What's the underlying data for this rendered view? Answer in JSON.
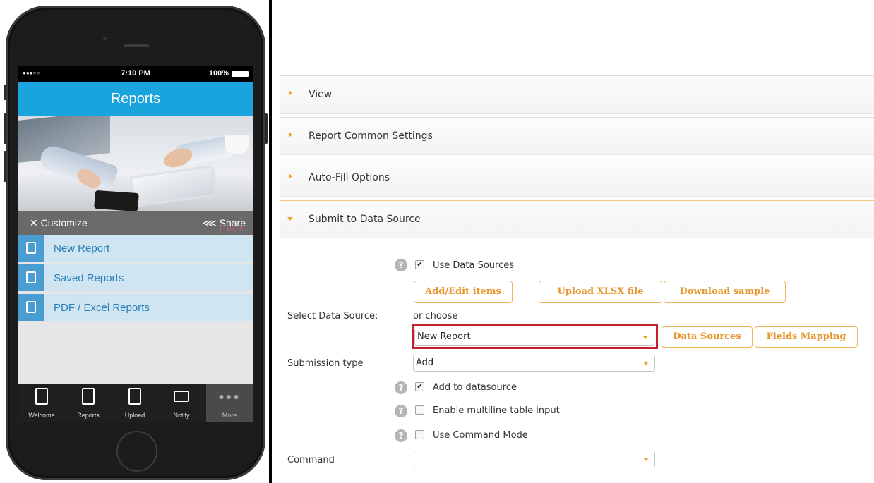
{
  "phone": {
    "status": {
      "signal": "●●●○○",
      "time": "7:10 PM",
      "battery": "100%"
    },
    "title": "Reports",
    "customize": "✕ Customize",
    "share": "⋘ Share",
    "ad_mark": "DOX",
    "menu": [
      {
        "label": "New Report",
        "icon": "new-document-icon"
      },
      {
        "label": "Saved Reports",
        "icon": "document-list-icon"
      },
      {
        "label": "PDF / Excel Reports",
        "icon": "export-icon"
      }
    ],
    "tabs": [
      {
        "label": "Welcome",
        "icon": "phone-icon"
      },
      {
        "label": "Reports",
        "icon": "documents-icon"
      },
      {
        "label": "Upload",
        "icon": "pdf-icon"
      },
      {
        "label": "Notify",
        "icon": "folder-icon"
      },
      {
        "label": "More",
        "icon": "more-dots-icon",
        "glyph": "●●●"
      }
    ]
  },
  "panel": {
    "sections": [
      {
        "title": "View"
      },
      {
        "title": "Report Common Settings"
      },
      {
        "title": "Auto-Fill Options"
      },
      {
        "title": "Submit to Data Source"
      }
    ],
    "use_data_sources": "Use Data Sources",
    "btn_add_edit": "Add/Edit items",
    "btn_upload": "Upload XLSX file",
    "btn_download": "Download sample",
    "select_ds_label": "Select Data Source:",
    "or_choose": "or choose",
    "data_source_value": "New Report",
    "btn_data_sources": "Data Sources",
    "btn_fields_mapping": "Fields Mapping",
    "submission_label": "Submission type",
    "submission_value": "Add",
    "add_to_ds": "Add to datasource",
    "multiline": "Enable multiline table input",
    "command_mode": "Use Command Mode",
    "command_label": "Command",
    "command_value": "",
    "help_glyph": "?",
    "check_glyph": "✔",
    "accent_color": "#f0a030",
    "highlight_color": "#c8202a"
  }
}
